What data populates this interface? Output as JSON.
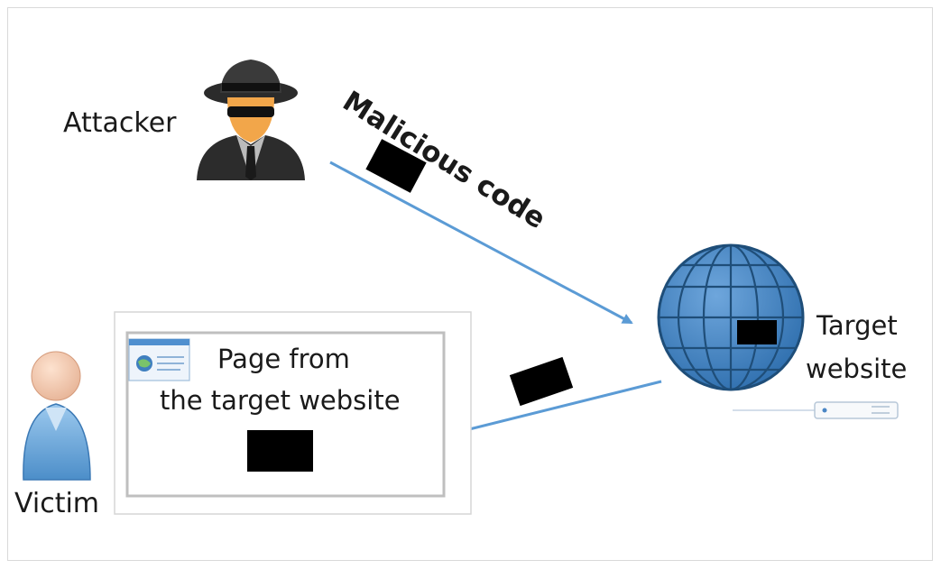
{
  "diagram": {
    "attacker_label": "Attacker",
    "malicious_code_label": "Malicious code",
    "target_label_line1": "Target",
    "target_label_line2": "website",
    "page_label_line1": "Page from",
    "page_label_line2": "the target website",
    "victim_label": "Victim"
  },
  "colors": {
    "arrow": "#5b9bd5",
    "globe": "#4a86c5",
    "globe_lines": "#1f4e79",
    "payload": "#000000"
  },
  "icons": [
    "attacker-icon",
    "globe-icon",
    "server-icon",
    "browser-icon",
    "victim-icon"
  ]
}
